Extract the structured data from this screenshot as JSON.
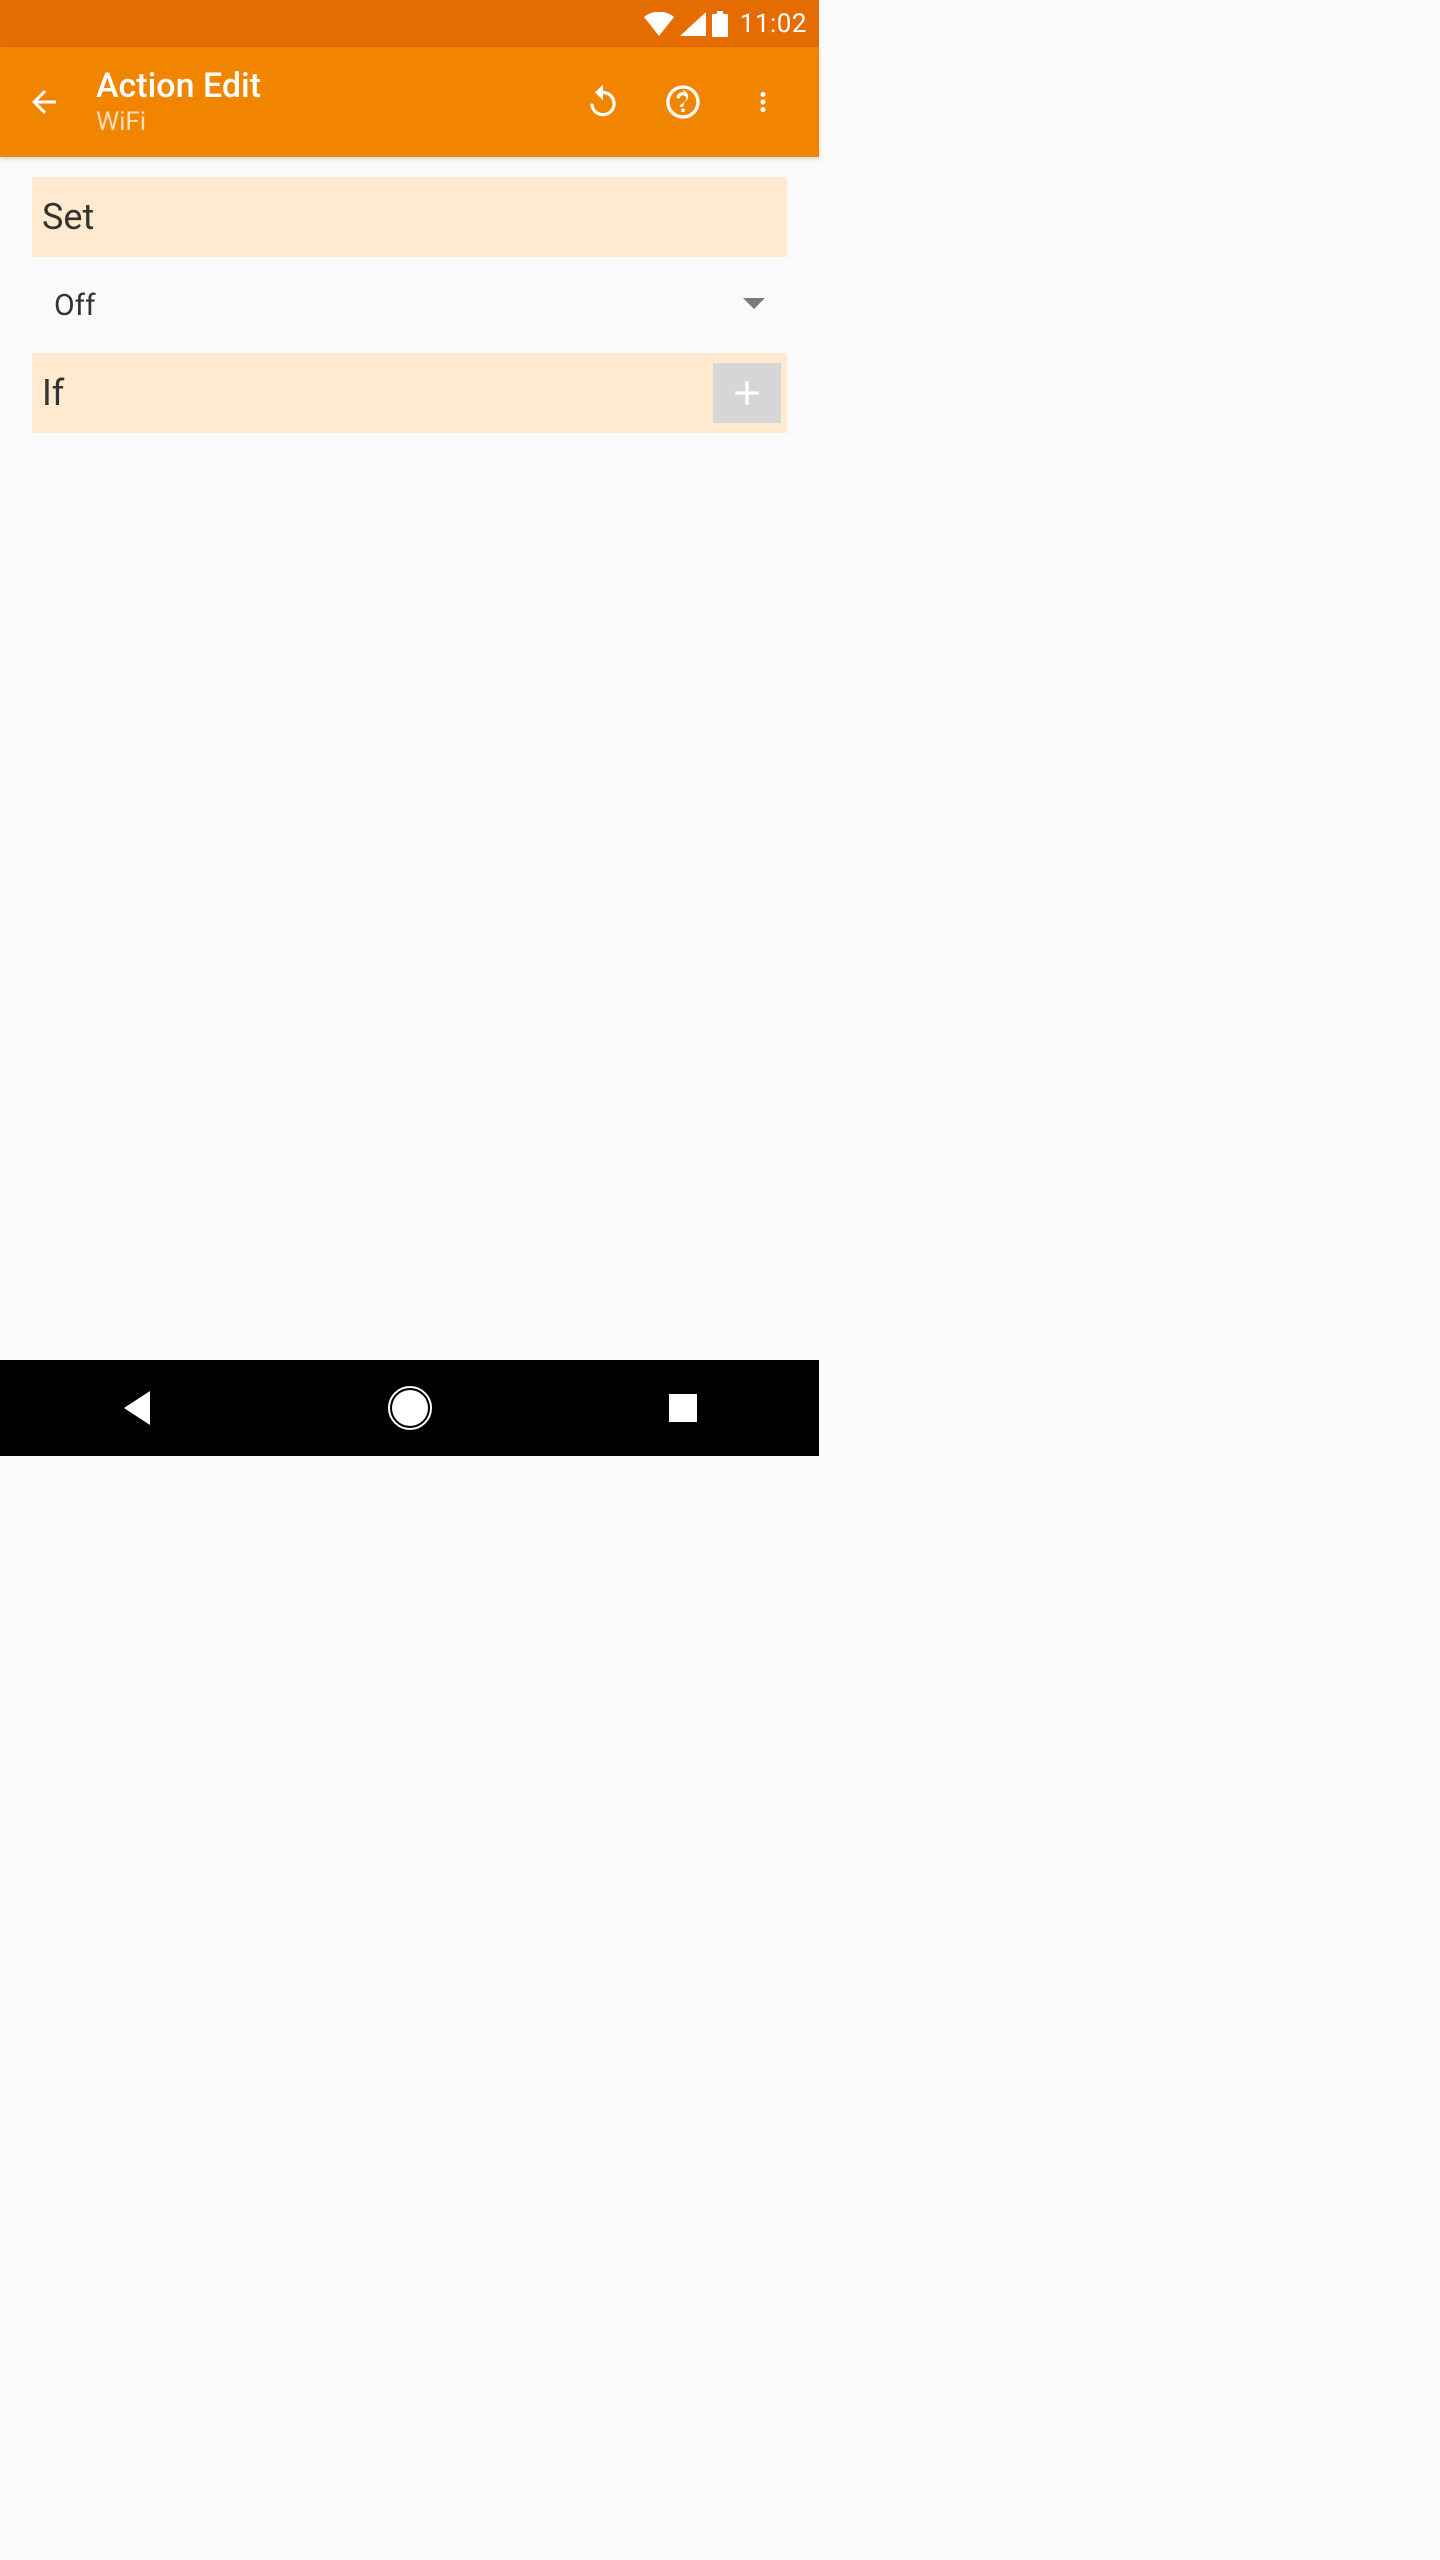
{
  "status_bar": {
    "time": "11:02"
  },
  "app_bar": {
    "title": "Action Edit",
    "subtitle": "WiFi"
  },
  "sections": {
    "set": {
      "label": "Set",
      "value": "Off"
    },
    "if": {
      "label": "If"
    }
  }
}
